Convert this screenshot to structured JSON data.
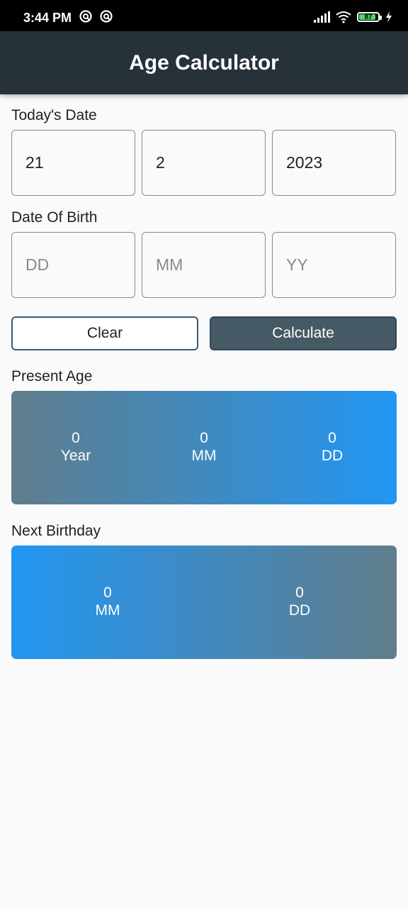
{
  "status_bar": {
    "time": "3:44 PM",
    "battery_level": "87",
    "icons": [
      "notification-icon",
      "notification-icon",
      "signal-icon",
      "wifi-icon",
      "battery-icon",
      "charging-icon"
    ]
  },
  "app_bar": {
    "title": "Age Calculator"
  },
  "todays_date": {
    "label": "Today's Date",
    "day": "21",
    "month": "2",
    "year": "2023"
  },
  "date_of_birth": {
    "label": "Date Of Birth",
    "day_placeholder": "DD",
    "month_placeholder": "MM",
    "year_placeholder": "YY"
  },
  "buttons": {
    "clear": "Clear",
    "calculate": "Calculate"
  },
  "present_age": {
    "label": "Present Age",
    "years": "0",
    "years_label": "Year",
    "months": "0",
    "months_label": "MM",
    "days": "0",
    "days_label": "DD"
  },
  "next_birthday": {
    "label": "Next Birthday",
    "months": "0",
    "months_label": "MM",
    "days": "0",
    "days_label": "DD"
  },
  "colors": {
    "app_bar": "#263238",
    "calculate_button": "#455a64",
    "gradient_grey": "#607d8b",
    "gradient_blue": "#2196f3"
  }
}
